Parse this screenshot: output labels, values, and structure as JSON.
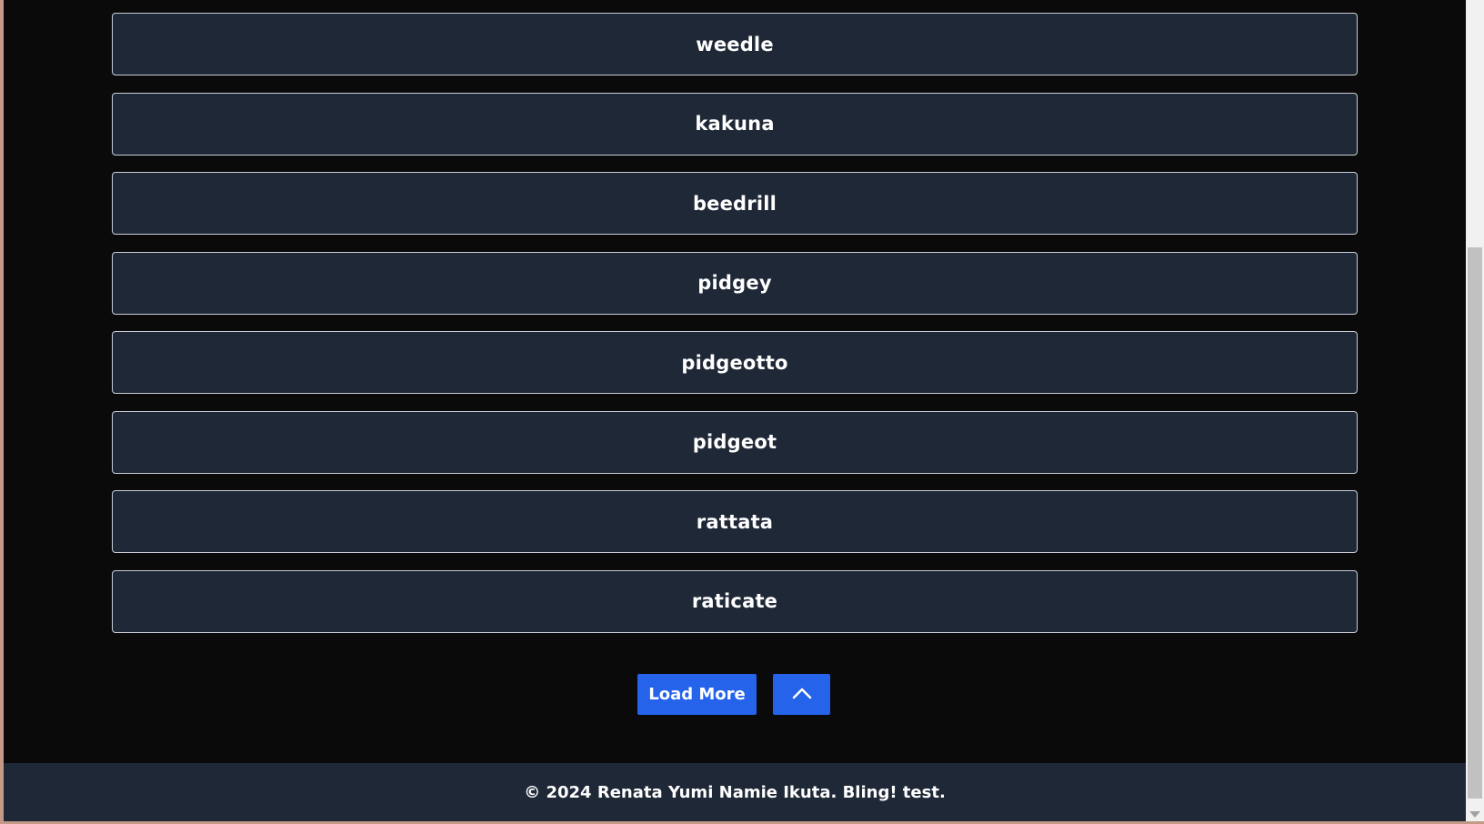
{
  "pokemon_list": [
    {
      "name": "weedle"
    },
    {
      "name": "kakuna"
    },
    {
      "name": "beedrill"
    },
    {
      "name": "pidgey"
    },
    {
      "name": "pidgeotto"
    },
    {
      "name": "pidgeot"
    },
    {
      "name": "rattata"
    },
    {
      "name": "raticate"
    }
  ],
  "actions": {
    "load_more_label": "Load More",
    "scroll_top_icon": "chevron-up-icon"
  },
  "footer": {
    "text": "© 2024 Renata Yumi Namie Ikuta. Bling! test."
  },
  "colors": {
    "page_background": "#0a0a0b",
    "card_background": "#1f2837",
    "card_border": "#c9ced6",
    "accent": "#2563eb",
    "text": "#ffffff"
  }
}
